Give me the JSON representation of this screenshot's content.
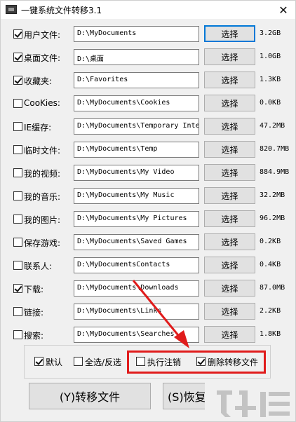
{
  "window": {
    "title": "一键系统文件转移3.1",
    "close_glyph": "✕"
  },
  "rows": [
    {
      "label": "用户文件:",
      "checked": true,
      "path": "D:\\MyDocuments",
      "button": "选择",
      "size": "3.2GB"
    },
    {
      "label": "桌面文件:",
      "checked": true,
      "path": "D:\\桌面",
      "button": "选择",
      "size": "1.0GB"
    },
    {
      "label": "收藏夹:",
      "checked": true,
      "path": "D:\\Favorites",
      "button": "选择",
      "size": "1.3KB"
    },
    {
      "label": "CooKies:",
      "checked": false,
      "path": "D:\\MyDocuments\\Cookies",
      "button": "选择",
      "size": "0.0KB"
    },
    {
      "label": "IE缓存:",
      "checked": false,
      "path": "D:\\MyDocuments\\Temporary Inte",
      "button": "选择",
      "size": "47.2MB"
    },
    {
      "label": "临时文件:",
      "checked": false,
      "path": "D:\\MyDocuments\\Temp",
      "button": "选择",
      "size": "820.7MB"
    },
    {
      "label": "我的视频:",
      "checked": false,
      "path": "D:\\MyDocuments\\My Video",
      "button": "选择",
      "size": "884.9MB"
    },
    {
      "label": "我的音乐:",
      "checked": false,
      "path": "D:\\MyDocuments\\My Music",
      "button": "选择",
      "size": "32.2MB"
    },
    {
      "label": "我的图片:",
      "checked": false,
      "path": "D:\\MyDocuments\\My Pictures",
      "button": "选择",
      "size": "96.2MB"
    },
    {
      "label": "保存游戏:",
      "checked": false,
      "path": "D:\\MyDocuments\\Saved Games",
      "button": "选择",
      "size": "0.2KB"
    },
    {
      "label": "联系人:",
      "checked": false,
      "path": "D:\\MyDocumentsContacts",
      "button": "选择",
      "size": "0.4KB"
    },
    {
      "label": "下载:",
      "checked": true,
      "path": "D:\\MyDocuments\\Downloads",
      "button": "选择",
      "size": "87.0MB"
    },
    {
      "label": "链接:",
      "checked": false,
      "path": "D:\\MyDocuments\\Links",
      "button": "选择",
      "size": "2.2KB"
    },
    {
      "label": "搜索:",
      "checked": false,
      "path": "D:\\MyDocuments\\Searches",
      "button": "选择",
      "size": "1.8KB"
    }
  ],
  "options": {
    "default": {
      "label": "默认",
      "checked": true
    },
    "select_all": {
      "label": "全选/反选",
      "checked": false
    },
    "exec_logout": {
      "label": "执行注销",
      "checked": false
    },
    "delete_moved": {
      "label": "删除转移文件",
      "checked": true
    }
  },
  "actions": {
    "transfer": "(Y)转移文件",
    "restore": "(S)恢复"
  },
  "colors": {
    "highlight_box": "#e01b1b",
    "focus_border": "#0078d7"
  }
}
